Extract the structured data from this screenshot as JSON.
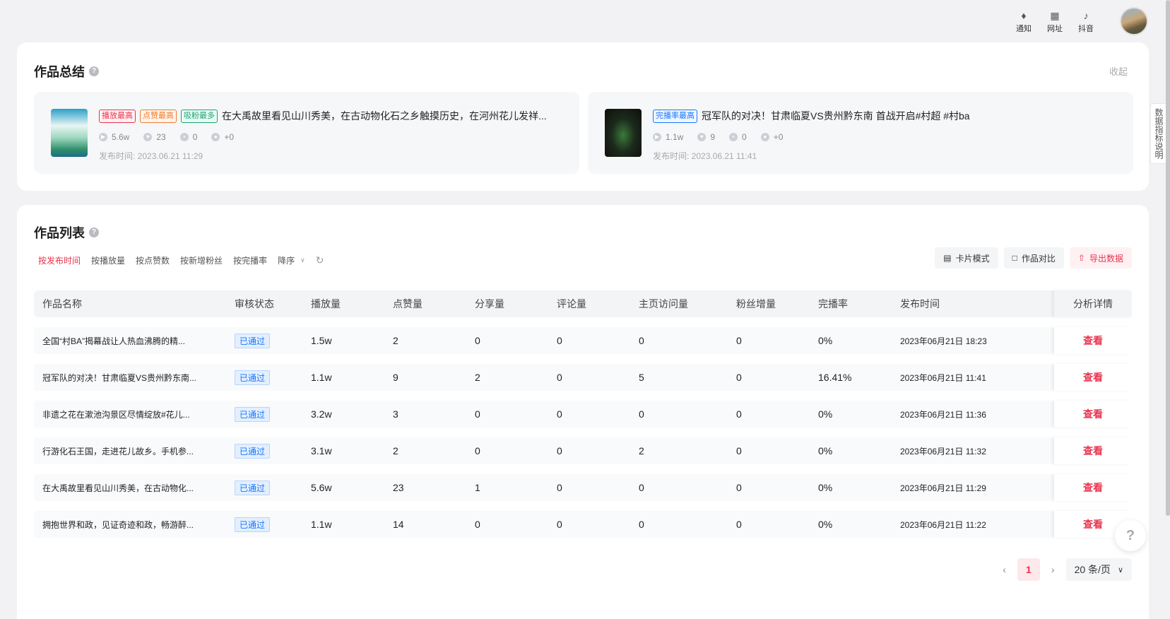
{
  "topbar": {
    "notify": {
      "icon": "bell-icon",
      "label": "通知"
    },
    "site": {
      "icon": "grid-icon",
      "label": "网址"
    },
    "douyin": {
      "icon": "tiktok-icon",
      "label": "抖音"
    }
  },
  "summary": {
    "title": "作品总结",
    "collapse": "收起",
    "items": [
      {
        "tags": [
          "播放最高",
          "点赞最高",
          "吸粉最多"
        ],
        "title": "在大禹故里看见山川秀美，在古动物化石之乡触摸历史，在河州花儿发祥...",
        "plays": "5.6w",
        "likes": "23",
        "comments": "0",
        "fans": "+0",
        "publish": "发布时间: 2023.06.21 11:29"
      },
      {
        "tags": [
          "完播率最高"
        ],
        "title": "冠军队的对决！甘肃临夏VS贵州黔东南 首战开启#村超 #村ba",
        "plays": "1.1w",
        "likes": "9",
        "comments": "0",
        "fans": "+0",
        "publish": "发布时间: 2023.06.21 11:41"
      }
    ]
  },
  "list": {
    "title": "作品列表",
    "filters": [
      "按发布时间",
      "按播放量",
      "按点赞数",
      "按新增粉丝",
      "按完播率"
    ],
    "sort": "降序",
    "actions": {
      "card": "卡片模式",
      "compare": "作品对比",
      "export": "导出数据"
    },
    "columns": [
      "作品名称",
      "审核状态",
      "播放量",
      "点赞量",
      "分享量",
      "评论量",
      "主页访问量",
      "粉丝增量",
      "完播率",
      "发布时间",
      "分析详情"
    ],
    "rows": [
      {
        "name": "全国“村BA”揭幕战让人热血沸腾的精...",
        "status": "已通过",
        "play": "1.5w",
        "like": "2",
        "share": "0",
        "comment": "0",
        "visit": "0",
        "fans": "0",
        "rate": "0%",
        "time": "2023年06月21日 18:23",
        "detail": "查看"
      },
      {
        "name": "冠军队的对决！甘肃临夏VS贵州黔东南...",
        "status": "已通过",
        "play": "1.1w",
        "like": "9",
        "share": "2",
        "comment": "0",
        "visit": "5",
        "fans": "0",
        "rate": "16.41%",
        "time": "2023年06月21日 11:41",
        "detail": "查看"
      },
      {
        "name": "非遗之花在漱池沟景区尽情绽放#花儿...",
        "status": "已通过",
        "play": "3.2w",
        "like": "3",
        "share": "0",
        "comment": "0",
        "visit": "0",
        "fans": "0",
        "rate": "0%",
        "time": "2023年06月21日 11:36",
        "detail": "查看"
      },
      {
        "name": "行游化石王国，走进花儿故乡。手机参...",
        "status": "已通过",
        "play": "3.1w",
        "like": "2",
        "share": "0",
        "comment": "0",
        "visit": "2",
        "fans": "0",
        "rate": "0%",
        "time": "2023年06月21日 11:32",
        "detail": "查看"
      },
      {
        "name": "在大禹故里看见山川秀美，在古动物化...",
        "status": "已通过",
        "play": "5.6w",
        "like": "23",
        "share": "1",
        "comment": "0",
        "visit": "0",
        "fans": "0",
        "rate": "0%",
        "time": "2023年06月21日 11:29",
        "detail": "查看"
      },
      {
        "name": "拥抱世界和政，见证奇迹和政，畅游醉...",
        "status": "已通过",
        "play": "1.1w",
        "like": "14",
        "share": "0",
        "comment": "0",
        "visit": "0",
        "fans": "0",
        "rate": "0%",
        "time": "2023年06月21日 11:22",
        "detail": "查看"
      }
    ],
    "pagination": {
      "current": "1",
      "page_size": "20 条/页"
    }
  },
  "side_tab": "数据指标说明"
}
